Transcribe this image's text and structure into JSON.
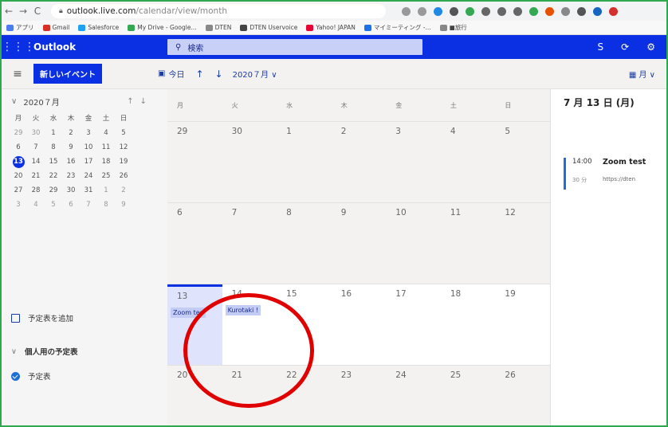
{
  "browser": {
    "nav_back": "←",
    "nav_forward": "→",
    "nav_reload": "C",
    "url_host": "outlook.live.com",
    "url_path": "/calendar/view/month",
    "bookmarks": [
      "アプリ",
      "Gmail",
      "Salesforce",
      "My Drive - Google...",
      "DTEN",
      "DTEN Uservoice",
      "Yahoo! JAPAN",
      "マイミーティング -...",
      "■旅行"
    ],
    "bookmark_colors": [
      "#4c7cf0",
      "#d93025",
      "#1ea1f2",
      "#34a853",
      "#888888",
      "#444444",
      "#e60033",
      "#1a73e8",
      "#888888"
    ],
    "extension_colors": [
      "#999999",
      "#999999",
      "#1e88e5",
      "#555555",
      "#34a853",
      "#666666",
      "#666666",
      "#666666",
      "#34a853",
      "#e65100",
      "#888888",
      "#555555",
      "#1565c0",
      "#d32f2f"
    ]
  },
  "topbar": {
    "app_name": "Outlook",
    "search_placeholder": "検索",
    "accent_color": "#0b30e4"
  },
  "command_bar": {
    "new_event": "新しいイベント",
    "today": "今日",
    "month_label": "2020７月 ∨",
    "view_label": "月 ∨"
  },
  "mini_calendar": {
    "title": "2020７月",
    "weekdays": [
      "月",
      "火",
      "水",
      "木",
      "金",
      "土",
      "日"
    ],
    "weeks": [
      [
        "29",
        "30",
        "1",
        "2",
        "3",
        "4",
        "5"
      ],
      [
        "6",
        "7",
        "8",
        "9",
        "10",
        "11",
        "12"
      ],
      [
        "13",
        "14",
        "15",
        "16",
        "17",
        "18",
        "19"
      ],
      [
        "20",
        "21",
        "22",
        "23",
        "24",
        "25",
        "26"
      ],
      [
        "27",
        "28",
        "29",
        "30",
        "31",
        "1",
        "2"
      ],
      [
        "3",
        "4",
        "5",
        "6",
        "7",
        "8",
        "9"
      ]
    ],
    "today": "13"
  },
  "sidebar": {
    "add_calendar": "予定表を追加",
    "group_label": "個人用の予定表",
    "calendar_name": "予定表"
  },
  "month_view": {
    "weekdays": [
      "月",
      "火",
      "水",
      "木",
      "金",
      "土",
      "日"
    ],
    "weeks": [
      [
        "29",
        "30",
        "1",
        "2",
        "3",
        "4",
        "5"
      ],
      [
        "6",
        "7",
        "8",
        "9",
        "10",
        "11",
        "12"
      ],
      [
        "13",
        "14",
        "15",
        "16",
        "17",
        "18",
        "19"
      ],
      [
        "20",
        "21",
        "22",
        "23",
        "24",
        "25",
        "26"
      ]
    ],
    "events": {
      "13": "Zoom tes",
      "14": "Kurotaki !"
    }
  },
  "right_pane": {
    "date_heading": "7 月 13 日 (月)",
    "event_time": "14:00",
    "event_duration": "30 分",
    "event_title": "Zoom test",
    "event_link": "https://dten"
  }
}
